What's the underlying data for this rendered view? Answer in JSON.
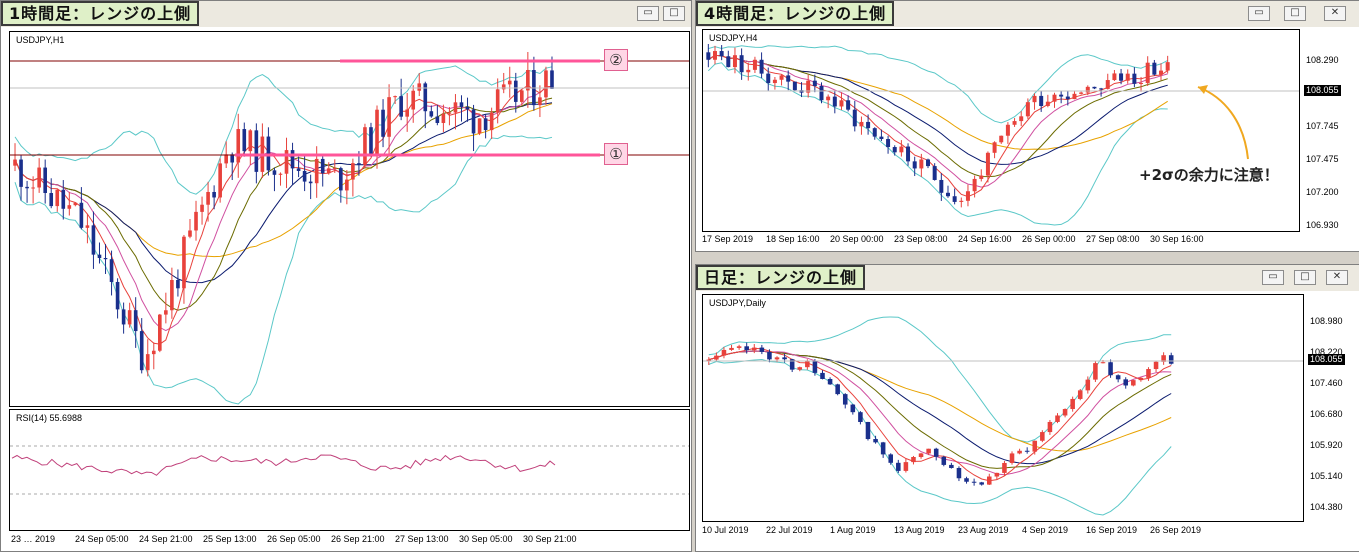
{
  "colors": {
    "bull": "#e8423c",
    "bear": "#1a2f8c",
    "bb": "#5bc8c8",
    "ma1": "#e8a200",
    "ma2": "#0a1a6e",
    "ma3": "#6b6b00",
    "ma4": "#d050a0",
    "ma5": "#e8423c",
    "level": "#ff5599",
    "rsi": "#c0407a",
    "arrow": "#f0a820"
  },
  "left": {
    "title": "1時間足：レンジの上側",
    "symbol": "USDJPY,H1",
    "rsi_label": "RSI(14) 55.6988",
    "markers": {
      "upper": "②",
      "lower": "①"
    },
    "time_labels": [
      "23 … 2019",
      "24 Sep 05:00",
      "24 Sep 21:00",
      "25 Sep 13:00",
      "26 Sep 05:00",
      "26 Sep 21:00",
      "27 Sep 13:00",
      "30 Sep 05:00",
      "30 Sep 21:00"
    ],
    "seed": 11,
    "n": 90,
    "start": 107.7,
    "end_value": 108.05
  },
  "h4": {
    "title": "4時間足：レンジの上側",
    "symbol": "USDJPY,H4",
    "price_labels": [
      "108.290",
      "108.055",
      "107.745",
      "107.475",
      "107.200",
      "106.930"
    ],
    "time_labels": [
      "17 Sep 2019",
      "18 Sep 16:00",
      "20 Sep 00:00",
      "23 Sep 08:00",
      "24 Sep 16:00",
      "26 Sep 00:00",
      "27 Sep 08:00",
      "30 Sep 16:00"
    ],
    "note": "+2σの余力に注意！",
    "current": "108.055",
    "seed": 23,
    "n": 70
  },
  "daily": {
    "title": "日足：レンジの上側",
    "symbol": "USDJPY,Daily",
    "price_labels": [
      "108.980",
      "108.220",
      "107.460",
      "106.680",
      "105.920",
      "105.140",
      "104.380"
    ],
    "current": "108.055",
    "time_labels": [
      "10 Jul 2019",
      "22 Jul 2019",
      "1 Aug 2019",
      "13 Aug 2019",
      "23 Aug 2019",
      "4 Sep 2019",
      "16 Sep 2019",
      "26 Sep 2019"
    ],
    "seed": 37,
    "n": 62
  },
  "window_buttons": {
    "min": "▭",
    "max": "□",
    "close": "✕"
  }
}
